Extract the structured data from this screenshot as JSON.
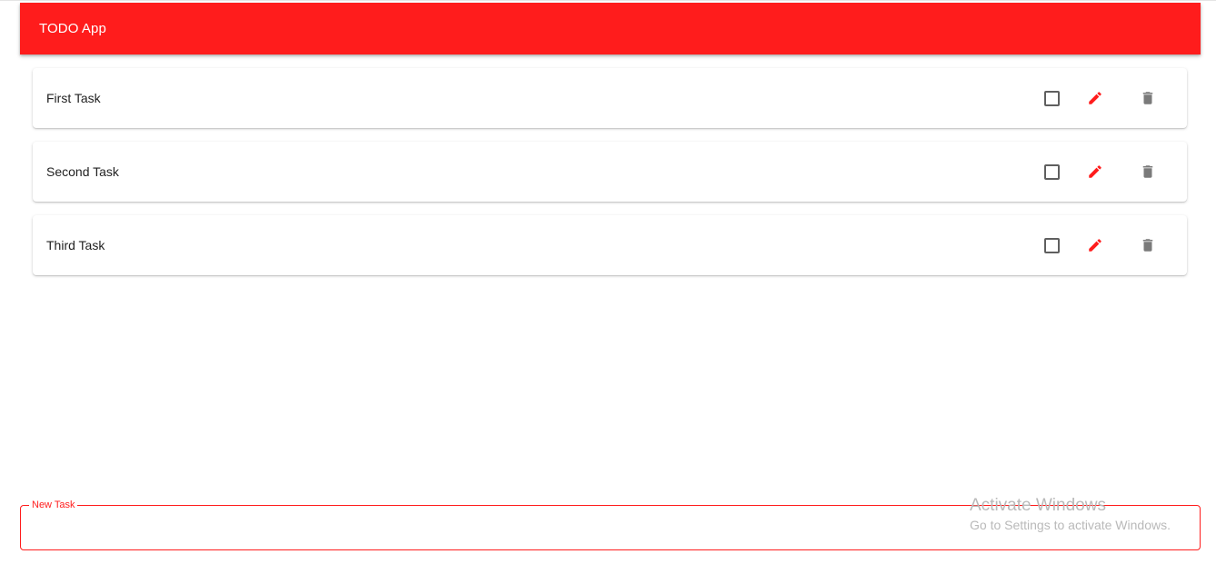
{
  "appbar": {
    "title": "TODO App",
    "color": "#ff1c1c"
  },
  "tasks": [
    {
      "label": "First Task",
      "checked": false
    },
    {
      "label": "Second Task",
      "checked": false
    },
    {
      "label": "Third Task",
      "checked": false
    }
  ],
  "task_actions": {
    "checkbox_icon": "checkbox-unchecked-icon",
    "edit_icon": "pencil-icon",
    "delete_icon": "trash-icon",
    "edit_color": "#ff1c1c",
    "delete_color": "#7a7a7a"
  },
  "new_task": {
    "label": "New Task",
    "value": ""
  },
  "watermark": {
    "title": "Activate Windows",
    "subtitle": "Go to Settings to activate Windows."
  }
}
